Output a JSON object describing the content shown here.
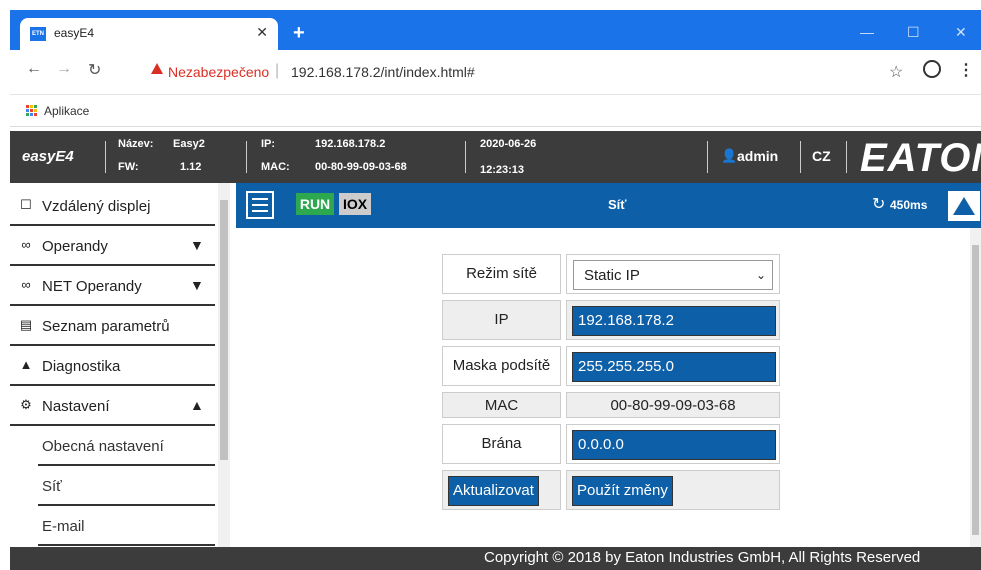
{
  "browser": {
    "tab_title": "easyE4",
    "tab_favicon_text": "ETN",
    "new_tab": "+",
    "minimize": "—",
    "maximize": "☐",
    "close": "✕",
    "insecure_label": "Nezabezpečeno",
    "url_separator": "|",
    "url": "192.168.178.2/int/index.html#",
    "bookmark_apps": "Aplikace"
  },
  "header": {
    "app_name": "easyE4",
    "name_label": "Název:",
    "name_value": "Easy2",
    "fw_label": "FW:",
    "fw_value": "1.12",
    "ip_label": "IP:",
    "ip_value": "192.168.178.2",
    "mac_label": "MAC:",
    "mac_value": "00-80-99-09-03-68",
    "date": "2020-06-26",
    "time": "12:23:13",
    "user": "admin",
    "language": "CZ",
    "logo": "EATON"
  },
  "sidebar": {
    "items": [
      {
        "label": "Vzdálený displej",
        "icon": "monitor-icon",
        "glyph": "☐"
      },
      {
        "label": "Operandy",
        "icon": "glasses-icon",
        "glyph": "∞",
        "arrow": "▼"
      },
      {
        "label": "NET Operandy",
        "icon": "glasses-icon",
        "glyph": "∞",
        "arrow": "▼"
      },
      {
        "label": "Seznam parametrů",
        "icon": "list-icon",
        "glyph": "▤"
      },
      {
        "label": "Diagnostika",
        "icon": "warning-icon",
        "glyph": "▲"
      },
      {
        "label": "Nastavení",
        "icon": "gear-icon",
        "glyph": "⚙",
        "arrow": "▲"
      }
    ],
    "subitems": [
      "Obecná nastavení",
      "Síť",
      "E-mail"
    ]
  },
  "toolbar": {
    "run": "RUN",
    "iox": "IOX",
    "title": "Síť",
    "refresh": "450ms"
  },
  "network": {
    "mode_label": "Režim sítě",
    "mode_value": "Static IP",
    "ip_label": "IP",
    "ip_value": "192.168.178.2",
    "mask_label": "Maska podsítě",
    "mask_value": "255.255.255.0",
    "mac_label": "MAC",
    "mac_value": "00-80-99-09-03-68",
    "gateway_label": "Brána",
    "gateway_value": "0.0.0.0",
    "refresh_button": "Aktualizovat",
    "apply_button": "Použít změny"
  },
  "footer": {
    "copyright": "Copyright © 2018 by Eaton Industries GmbH, All Rights Reserved"
  },
  "colors": {
    "accent": "#0d5fa8",
    "chrome": "#1a73e8",
    "header": "#3c3c3c",
    "run": "#2ea84f"
  }
}
